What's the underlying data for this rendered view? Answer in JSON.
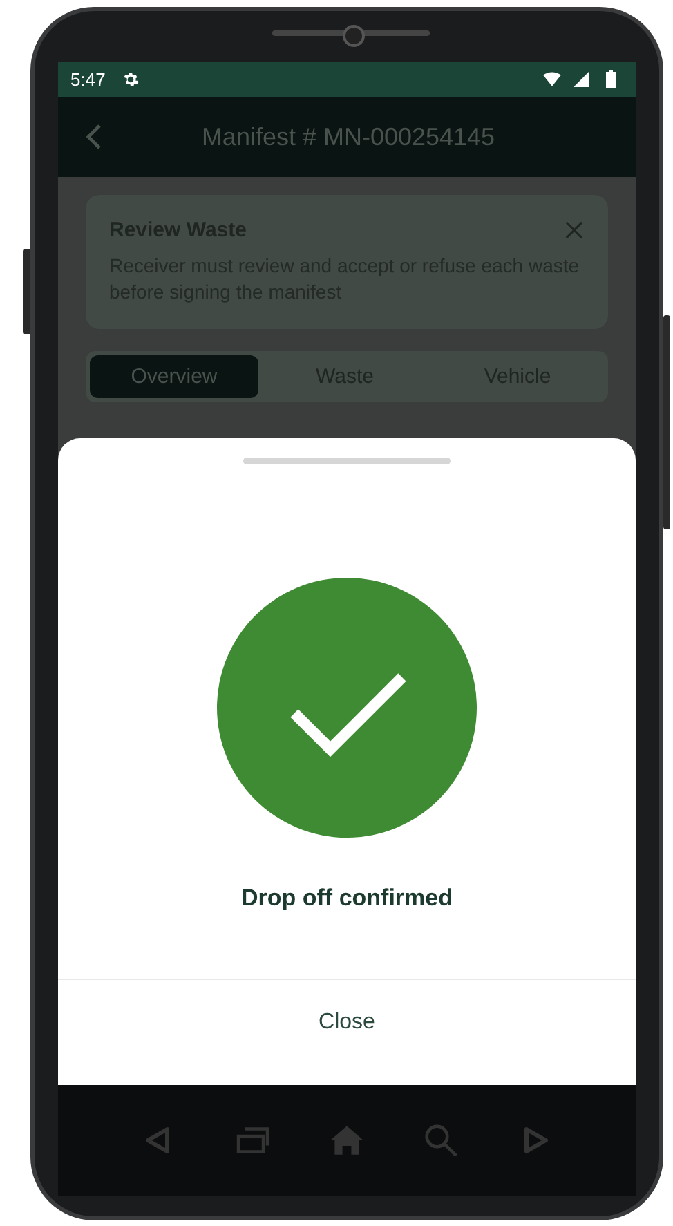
{
  "status_bar": {
    "time": "5:47"
  },
  "app_bar": {
    "title": "Manifest # MN-000254145"
  },
  "banner": {
    "title": "Review Waste",
    "message": "Receiver must review and accept or refuse each waste before signing the manifest"
  },
  "tabs": [
    {
      "label": "Overview",
      "selected": true
    },
    {
      "label": "Waste",
      "selected": false
    },
    {
      "label": "Vehicle",
      "selected": false
    }
  ],
  "sheet": {
    "message": "Drop off confirmed",
    "close_label": "Close"
  }
}
